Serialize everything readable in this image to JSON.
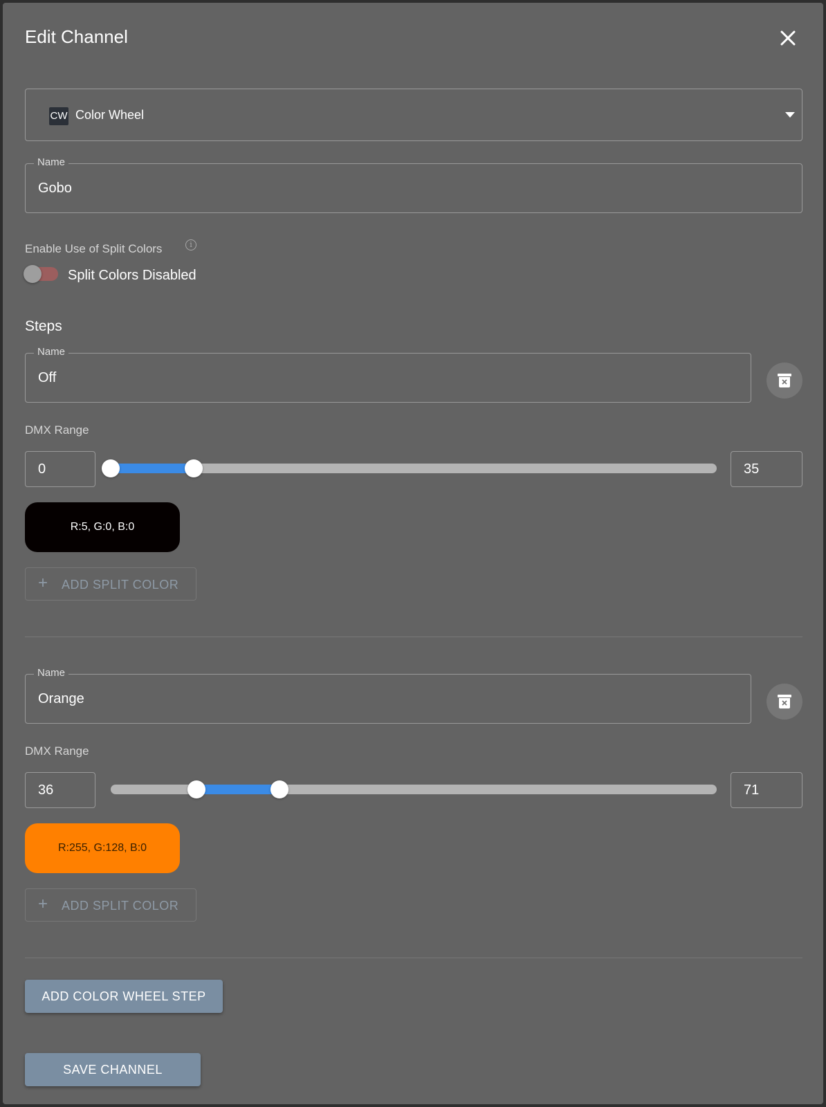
{
  "dialog": {
    "title": "Edit Channel"
  },
  "channel_type": {
    "badge": "CW",
    "value": "Color Wheel"
  },
  "name_field": {
    "label": "Name",
    "value": "Gobo"
  },
  "split_colors": {
    "label": "Enable Use of Split Colors",
    "info_symbol": "i",
    "toggle_label": "Split Colors Disabled",
    "enabled": false
  },
  "steps": {
    "heading": "Steps",
    "items": [
      {
        "name_label": "Name",
        "name": "Off",
        "range_label": "DMX Range",
        "min": "0",
        "max": "35",
        "range_start": 0,
        "range_end": 35,
        "color_label": "R:5, G:0, B:0",
        "color": "#050000",
        "color_text": "#ffffff",
        "add_split_label": "ADD SPLIT COLOR",
        "add_split_icon": "+"
      },
      {
        "name_label": "Name",
        "name": "Orange",
        "range_label": "DMX Range",
        "min": "36",
        "max": "71",
        "range_start": 36,
        "range_end": 71,
        "color_label": "R:255, G:128, B:0",
        "color": "#ff8000",
        "color_text": "#3a2000",
        "add_split_label": "ADD SPLIT COLOR",
        "add_split_icon": "+"
      }
    ]
  },
  "actions": {
    "add_step_label": "ADD COLOR WHEEL STEP",
    "save_label": "SAVE CHANNEL"
  },
  "colors": {
    "dialog_bg": "#636363",
    "slider_active": "#3b8be6",
    "button_bg": "#7a8ea2"
  }
}
